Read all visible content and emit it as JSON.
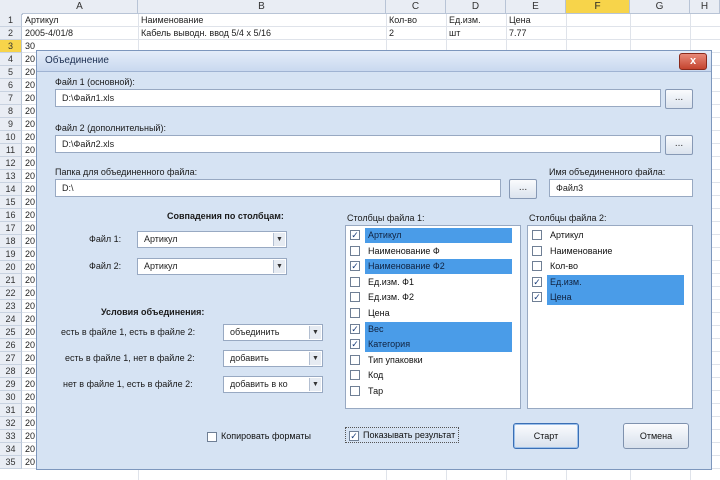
{
  "spreadsheet": {
    "columns": [
      "A",
      "B",
      "C",
      "D",
      "E",
      "F",
      "G",
      "H"
    ],
    "selected_column": "F",
    "rows": [
      "1",
      "2",
      "3",
      "4",
      "5",
      "6",
      "7",
      "8",
      "9",
      "10",
      "11",
      "12",
      "13",
      "14",
      "15",
      "16",
      "17",
      "18",
      "19",
      "20",
      "21",
      "22",
      "23",
      "24",
      "25",
      "26",
      "27",
      "28",
      "29",
      "30",
      "31",
      "32",
      "33",
      "34",
      "35"
    ],
    "selected_row": "3",
    "row1": [
      "Артикул",
      "Наименование",
      "Кол-во",
      "Ед.изм.",
      "Цена"
    ],
    "row2": [
      "2005-4/01/8",
      "Кабель выводн. ввод 5/4 х 5/16",
      "2",
      "шт",
      "7.77"
    ],
    "row_stubs": [
      "30",
      "20",
      "20",
      "20",
      "20",
      "20",
      "20",
      "20",
      "20",
      "20",
      "20",
      "20",
      "20",
      "20",
      "20",
      "20",
      "20",
      "20",
      "20",
      "20",
      "20",
      "20",
      "20",
      "20",
      "20",
      "20",
      "20",
      "20",
      "20",
      "20",
      "20",
      "20",
      "20"
    ]
  },
  "dialog": {
    "title": "Объединение",
    "close_label": "x",
    "file1_label": "Файл 1 (основной):",
    "file1_value": "D:\\Файл1.xls",
    "file2_label": "Файл 2 (дополнительный):",
    "file2_value": "D:\\Файл2.xls",
    "browse_label": "...",
    "folder_label": "Папка для объединенного файла:",
    "folder_value": "D:\\",
    "name_label": "Имя объединенного файла:",
    "name_value": "Файл3",
    "key_title": "Совпадения по столбцам:",
    "key1_label": "Файл 1:",
    "key1_value": "Артикул",
    "key2_label": "Файл 2:",
    "key2_value": "Артикул",
    "cond_title": "Условия объединения:",
    "cond1_label": "есть в файле 1, есть в файле 2:",
    "cond1_value": "объединить",
    "cond2_label": "есть в файле 1, нет в файле 2:",
    "cond2_value": "добавить",
    "cond3_label": "нет в файле 1, есть в файле 2:",
    "cond3_value": "добавить в ко",
    "combo_arrow": "▼",
    "list1_title": "Столбцы файла 1:",
    "list1": [
      {
        "label": "Артикул",
        "checked": true,
        "highlighted": true
      },
      {
        "label": "Наименование Ф",
        "checked": false,
        "highlighted": false
      },
      {
        "label": "Наименование Ф2",
        "checked": true,
        "highlighted": true
      },
      {
        "label": "Ед.изм. Ф1",
        "checked": false,
        "highlighted": false
      },
      {
        "label": "Ед.изм. Ф2",
        "checked": false,
        "highlighted": false
      },
      {
        "label": "Цена",
        "checked": false,
        "highlighted": false
      },
      {
        "label": "Вес",
        "checked": true,
        "highlighted": true
      },
      {
        "label": "Категория",
        "checked": true,
        "highlighted": true
      },
      {
        "label": "Тип упаковки",
        "checked": false,
        "highlighted": false
      },
      {
        "label": "Код",
        "checked": false,
        "highlighted": false
      },
      {
        "label": "Тар",
        "checked": false,
        "highlighted": false
      }
    ],
    "list2_title": "Столбцы файла 2:",
    "list2": [
      {
        "label": "Артикул",
        "checked": false,
        "highlighted": false
      },
      {
        "label": "Наименование",
        "checked": false,
        "highlighted": false
      },
      {
        "label": "Кол-во",
        "checked": false,
        "highlighted": false
      },
      {
        "label": "Ед.изм.",
        "checked": true,
        "highlighted": true
      },
      {
        "label": "Цена",
        "checked": true,
        "highlighted": true
      }
    ],
    "check_mark": "✓",
    "opt1_label": "Копировать форматы",
    "opt1_checked": false,
    "opt2_label": "Показывать результат",
    "opt2_checked": true,
    "start_label": "Старт",
    "cancel_label": "Отмена"
  }
}
